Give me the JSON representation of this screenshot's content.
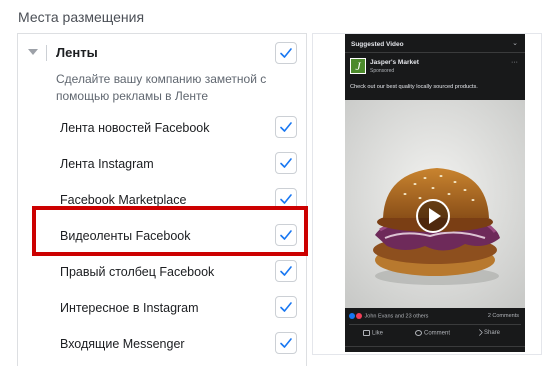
{
  "section_title": "Места размещения",
  "feeds": {
    "label": "Ленты",
    "description": "Сделайте вашу компанию заметной с помощью рекламы в Ленте",
    "checked": true
  },
  "options": [
    {
      "label": "Лента новостей Facebook",
      "checked": true
    },
    {
      "label": "Лента Instagram",
      "checked": true
    },
    {
      "label": "Facebook Marketplace",
      "checked": true
    },
    {
      "label": "Видеоленты Facebook",
      "checked": true,
      "highlighted": true
    },
    {
      "label": "Правый столбец Facebook",
      "checked": true
    },
    {
      "label": "Интересное в Instagram",
      "checked": true
    },
    {
      "label": "Входящие Messenger",
      "checked": true
    }
  ],
  "preview": {
    "header": "Suggested Video",
    "page_name": "Jasper's Market",
    "sponsored": "Sponsored",
    "post_text": "Check out our best quality locally sourced products.",
    "reactions": "John Evans and 23 others",
    "comments": "2 Comments",
    "like": "Like",
    "comment": "Comment",
    "share": "Share"
  },
  "colors": {
    "checkmark": "#1877f2",
    "highlight": "#cc0000"
  }
}
